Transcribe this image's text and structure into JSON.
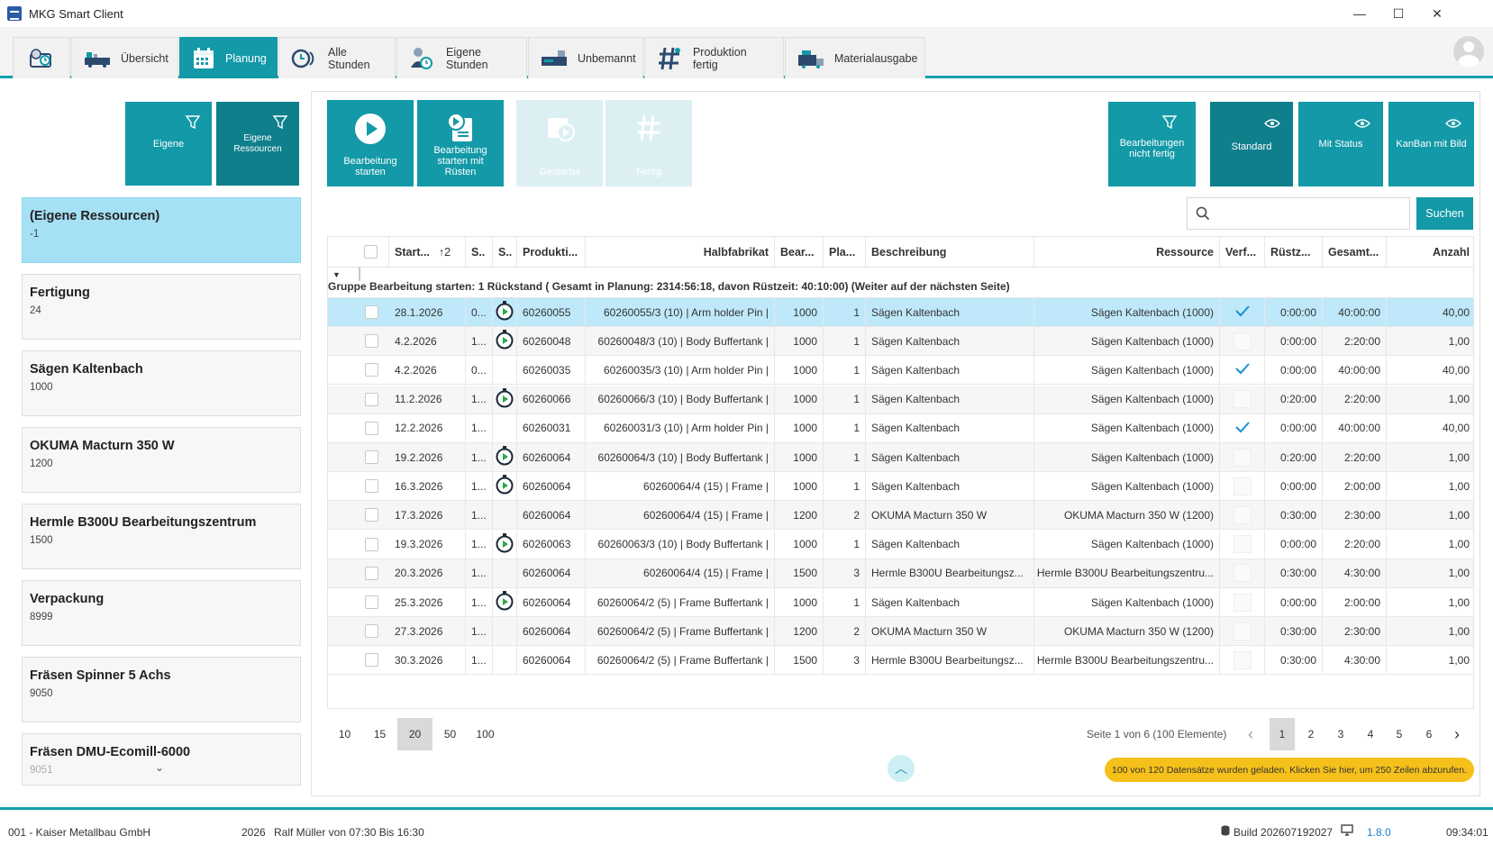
{
  "window": {
    "title": "MKG Smart Client",
    "minimize": "—",
    "maximize": "☐",
    "close": "✕"
  },
  "tabs": [
    {
      "label": "",
      "icon": "dashboard-clock-icon"
    },
    {
      "label": "Übersicht",
      "icon": "overview-icon"
    },
    {
      "label": "Planung",
      "icon": "calendar-icon",
      "active": true
    },
    {
      "label": "Alle Stunden",
      "icon": "hours-icon"
    },
    {
      "label": "Eigene Stunden",
      "icon": "user-hours-icon"
    },
    {
      "label": "Unbemannt",
      "icon": "machine-icon"
    },
    {
      "label": "Produktion fertig",
      "icon": "production-done-icon"
    },
    {
      "label": "Materialausgabe",
      "icon": "material-icon"
    }
  ],
  "filters": {
    "eigene": "Eigene",
    "eigene_ressourcen_1": "Eigene",
    "eigene_ressourcen_2": "Ressourcen"
  },
  "resources": [
    {
      "name": "(Eigene Ressourcen)",
      "num": "-1",
      "selected": true
    },
    {
      "name": "Fertigung",
      "num": "24"
    },
    {
      "name": "Sägen Kaltenbach",
      "num": "1000"
    },
    {
      "name": "OKUMA Macturn 350 W",
      "num": "1200"
    },
    {
      "name": "Hermle B300U Bearbeitungszentrum",
      "num": "1500"
    },
    {
      "name": "Verpackung",
      "num": "8999"
    },
    {
      "name": "Fräsen Spinner 5 Achs",
      "num": "9050"
    },
    {
      "name": "Fräsen DMU-Ecomill-6000",
      "num": "9051"
    }
  ],
  "actions": {
    "start_1": "Bearbeitung",
    "start_2": "starten",
    "start_ruesten_1": "Bearbeitung",
    "start_ruesten_2": "starten mit",
    "start_ruesten_3": "Rüsten",
    "gestartet": "Gestartet",
    "fertig": "Fertig"
  },
  "views": {
    "not_done_1": "Bearbeitungen",
    "not_done_2": "nicht fertig",
    "standard": "Standard",
    "mit_status": "Mit Status",
    "kanban": "KanBan mit Bild"
  },
  "search": {
    "placeholder": "",
    "button": "Suchen"
  },
  "grid": {
    "headers": {
      "start": "Start...",
      "sort_index": "2",
      "s1": "S..",
      "s2": "S..",
      "produkt": "Produkti...",
      "halbfabrikat": "Halbfabrikat",
      "bear": "Bear...",
      "pla": "Pla...",
      "beschreibung": "Beschreibung",
      "ressource": "Ressource",
      "verf": "Verf...",
      "ruest": "Rüstz...",
      "gesamt": "Gesamt...",
      "anzahl": "Anzahl"
    },
    "group_label": "Gruppe Bearbeitung starten: 1 Rückstand ( Gesamt in Planung: 2314:56:18, davon Rüstzeit: 40:10:00) (Weiter auf der nächsten Seite)",
    "rows": [
      {
        "start": "28.1.2026",
        "s": "0...",
        "timer": true,
        "prod": "60260055",
        "halb": "60260055/3 (10) | Arm holder Pin |",
        "bear": "1000",
        "pla": "1",
        "besch": "Sägen Kaltenbach",
        "res": "Sägen Kaltenbach (1000)",
        "verf": true,
        "ruest": "0:00:00",
        "gesamt": "40:00:00",
        "anzahl": "40,00"
      },
      {
        "start": "4.2.2026",
        "s": "1...",
        "timer": true,
        "prod": "60260048",
        "halb": "60260048/3 (10) | Body Buffertank |",
        "bear": "1000",
        "pla": "1",
        "besch": "Sägen Kaltenbach",
        "res": "Sägen Kaltenbach (1000)",
        "verf": false,
        "ruest": "0:00:00",
        "gesamt": "2:20:00",
        "anzahl": "1,00"
      },
      {
        "start": "4.2.2026",
        "s": "0...",
        "timer": false,
        "prod": "60260035",
        "halb": "60260035/3 (10) | Arm holder Pin |",
        "bear": "1000",
        "pla": "1",
        "besch": "Sägen Kaltenbach",
        "res": "Sägen Kaltenbach (1000)",
        "verf": true,
        "ruest": "0:00:00",
        "gesamt": "40:00:00",
        "anzahl": "40,00"
      },
      {
        "start": "11.2.2026",
        "s": "1...",
        "timer": true,
        "prod": "60260066",
        "halb": "60260066/3 (10) | Body Buffertank |",
        "bear": "1000",
        "pla": "1",
        "besch": "Sägen Kaltenbach",
        "res": "Sägen Kaltenbach (1000)",
        "verf": false,
        "ruest": "0:20:00",
        "gesamt": "2:20:00",
        "anzahl": "1,00"
      },
      {
        "start": "12.2.2026",
        "s": "1...",
        "timer": false,
        "prod": "60260031",
        "halb": "60260031/3 (10) | Arm holder Pin |",
        "bear": "1000",
        "pla": "1",
        "besch": "Sägen Kaltenbach",
        "res": "Sägen Kaltenbach (1000)",
        "verf": true,
        "ruest": "0:00:00",
        "gesamt": "40:00:00",
        "anzahl": "40,00"
      },
      {
        "start": "19.2.2026",
        "s": "1...",
        "timer": true,
        "prod": "60260064",
        "halb": "60260064/3 (10) | Body Buffertank |",
        "bear": "1000",
        "pla": "1",
        "besch": "Sägen Kaltenbach",
        "res": "Sägen Kaltenbach (1000)",
        "verf": false,
        "ruest": "0:20:00",
        "gesamt": "2:20:00",
        "anzahl": "1,00"
      },
      {
        "start": "16.3.2026",
        "s": "1...",
        "timer": true,
        "prod": "60260064",
        "halb": "60260064/4 (15) | Frame |",
        "bear": "1000",
        "pla": "1",
        "besch": "Sägen Kaltenbach",
        "res": "Sägen Kaltenbach (1000)",
        "verf": false,
        "ruest": "0:00:00",
        "gesamt": "2:00:00",
        "anzahl": "1,00"
      },
      {
        "start": "17.3.2026",
        "s": "1...",
        "timer": false,
        "prod": "60260064",
        "halb": "60260064/4 (15) | Frame |",
        "bear": "1200",
        "pla": "2",
        "besch": "OKUMA Macturn 350 W",
        "res": "OKUMA Macturn 350 W (1200)",
        "verf": false,
        "ruest": "0:30:00",
        "gesamt": "2:30:00",
        "anzahl": "1,00"
      },
      {
        "start": "19.3.2026",
        "s": "1...",
        "timer": true,
        "prod": "60260063",
        "halb": "60260063/3 (10) | Body Buffertank |",
        "bear": "1000",
        "pla": "1",
        "besch": "Sägen Kaltenbach",
        "res": "Sägen Kaltenbach (1000)",
        "verf": false,
        "ruest": "0:00:00",
        "gesamt": "2:20:00",
        "anzahl": "1,00"
      },
      {
        "start": "20.3.2026",
        "s": "1...",
        "timer": false,
        "prod": "60260064",
        "halb": "60260064/4 (15) | Frame |",
        "bear": "1500",
        "pla": "3",
        "besch": "Hermle B300U Bearbeitungsz...",
        "res": "Hermle B300U Bearbeitungszentru...",
        "verf": false,
        "ruest": "0:30:00",
        "gesamt": "4:30:00",
        "anzahl": "1,00"
      },
      {
        "start": "25.3.2026",
        "s": "1...",
        "timer": true,
        "prod": "60260064",
        "halb": "60260064/2 (5) | Frame Buffertank |",
        "bear": "1000",
        "pla": "1",
        "besch": "Sägen Kaltenbach",
        "res": "Sägen Kaltenbach (1000)",
        "verf": false,
        "ruest": "0:00:00",
        "gesamt": "2:00:00",
        "anzahl": "1,00"
      },
      {
        "start": "27.3.2026",
        "s": "1...",
        "timer": false,
        "prod": "60260064",
        "halb": "60260064/2 (5) | Frame Buffertank |",
        "bear": "1200",
        "pla": "2",
        "besch": "OKUMA Macturn 350 W",
        "res": "OKUMA Macturn 350 W (1200)",
        "verf": false,
        "ruest": "0:30:00",
        "gesamt": "2:30:00",
        "anzahl": "1,00"
      },
      {
        "start": "30.3.2026",
        "s": "1...",
        "timer": false,
        "prod": "60260064",
        "halb": "60260064/2 (5) | Frame Buffertank |",
        "bear": "1500",
        "pla": "3",
        "besch": "Hermle B300U Bearbeitungsz...",
        "res": "Hermle B300U Bearbeitungszentru...",
        "verf": false,
        "ruest": "0:30:00",
        "gesamt": "4:30:00",
        "anzahl": "1,00"
      }
    ]
  },
  "pager": {
    "sizes": [
      "10",
      "15",
      "20",
      "50",
      "100"
    ],
    "active_size": "20",
    "info": "Seite 1 von 6 (100 Elemente)",
    "pages": [
      "1",
      "2",
      "3",
      "4",
      "5",
      "6"
    ],
    "active_page": "1",
    "prev": "‹",
    "next": "›"
  },
  "load_message": "100 von 120 Datensätze wurden geladen. Klicken Sie hier, um 250 Zeilen abzurufen.",
  "status": {
    "company": "001 - Kaiser Metallbau GmbH",
    "year": "2026",
    "user": "Ralf Müller von 07:30 Bis 16:30",
    "build": "Build 202607192027",
    "version": "1.8.0",
    "time": "09:34:01"
  },
  "colors": {
    "accent": "#1399a7",
    "accent_dark": "#0f7f8c",
    "selected_row": "#bfe9fb",
    "selected_card": "#a5e0f5",
    "warning": "#f5c01a"
  }
}
